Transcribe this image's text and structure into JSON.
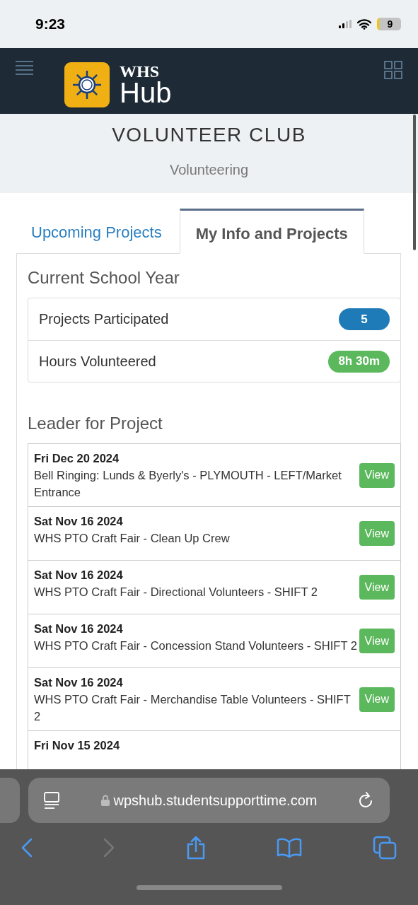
{
  "status_bar": {
    "time": "9:23",
    "battery": "9"
  },
  "header": {
    "logo_line_1": "WHS",
    "logo_line_2": "Hub"
  },
  "page_title": "VOLUNTEER CLUB",
  "page_subtitle": "Volunteering",
  "tabs": [
    {
      "label": "Upcoming Projects",
      "selected": false
    },
    {
      "label": "My Info and Projects",
      "selected": true
    }
  ],
  "current_year": {
    "heading": "Current School Year",
    "stats": [
      {
        "label": "Projects Participated",
        "value": "5",
        "color": "#1f7bb8"
      },
      {
        "label": "Hours Volunteered",
        "value": "8h 30m",
        "color": "#5cb85c"
      }
    ]
  },
  "leader": {
    "heading": "Leader for Project",
    "projects": [
      {
        "date": "Fri Dec 20 2024",
        "title": "Bell Ringing: Lunds & Byerly's - PLYMOUTH - LEFT/Market Entrance",
        "button": "View"
      },
      {
        "date": "Sat Nov 16 2024",
        "title": "WHS PTO Craft Fair - Clean Up Crew",
        "button": "View"
      },
      {
        "date": "Sat Nov 16 2024",
        "title": "WHS PTO Craft Fair - Directional Volunteers - SHIFT 2",
        "button": "View"
      },
      {
        "date": "Sat Nov 16 2024",
        "title": "WHS PTO Craft Fair - Concession Stand Volunteers - SHIFT 2",
        "button": "View"
      },
      {
        "date": "Sat Nov 16 2024",
        "title": "WHS PTO Craft Fair - Merchandise Table Volunteers - SHIFT 2",
        "button": "View"
      },
      {
        "date": "Fri Nov 15 2024"
      }
    ]
  },
  "browser": {
    "url": "wpshub.studentsupporttime.com"
  }
}
